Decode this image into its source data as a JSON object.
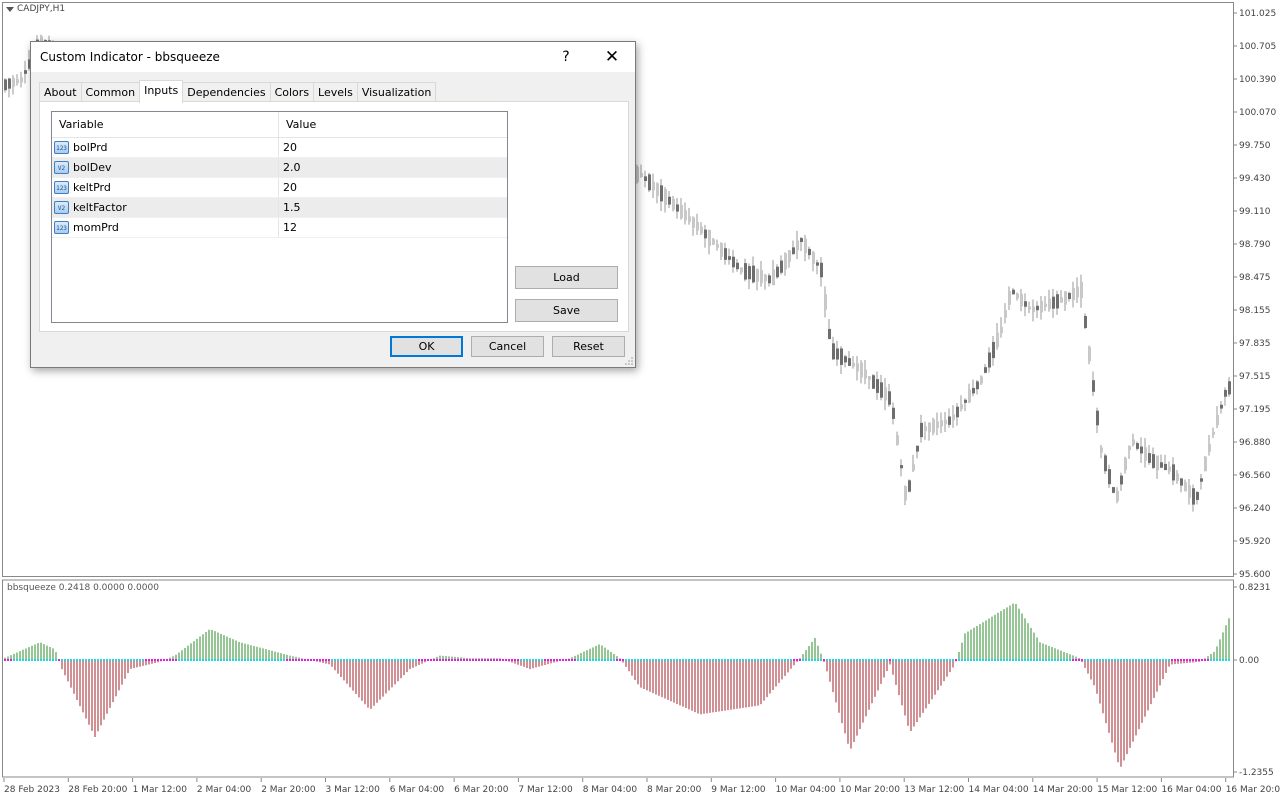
{
  "symbol": {
    "label": "CADJPY,H1"
  },
  "chart": {
    "price_ticks": [
      "101.025",
      "100.705",
      "100.390",
      "100.070",
      "99.750",
      "99.430",
      "99.110",
      "98.790",
      "98.475",
      "98.155",
      "97.835",
      "97.515",
      "97.195",
      "96.880",
      "96.560",
      "96.240",
      "95.920",
      "95.600"
    ],
    "time_ticks": [
      "28 Feb 2023",
      "28 Feb 20:00",
      "1 Mar 12:00",
      "2 Mar 04:00",
      "2 Mar 20:00",
      "3 Mar 12:00",
      "6 Mar 04:00",
      "6 Mar 20:00",
      "7 Mar 12:00",
      "8 Mar 04:00",
      "8 Mar 20:00",
      "9 Mar 12:00",
      "10 Mar 04:00",
      "10 Mar 20:00",
      "13 Mar 12:00",
      "14 Mar 04:00",
      "14 Mar 20:00",
      "15 Mar 12:00",
      "16 Mar 04:00",
      "16 Mar 20:00"
    ]
  },
  "indicator": {
    "label": "bbsqueeze 0.2418 0.0000 0.0000",
    "ticks": [
      "0.8231",
      "0.00",
      "-1.2355"
    ],
    "colors": {
      "up": "#2e8b2e",
      "down": "#a0202a",
      "squeeze_on": "#e020e0",
      "squeeze_off": "#20d8e0"
    }
  },
  "chart_data": {
    "type": "bar",
    "title": "bbsqueeze",
    "ylim": [
      -1.2355,
      0.8231
    ],
    "series": [
      {
        "name": "bbsqueeze",
        "last_value": 0.2418
      }
    ]
  },
  "dialog": {
    "title": "Custom Indicator - bbsqueeze",
    "help": "?",
    "close": "✕",
    "tabs": [
      "About",
      "Common",
      "Inputs",
      "Dependencies",
      "Colors",
      "Levels",
      "Visualization"
    ],
    "active_tab": "Inputs",
    "grid": {
      "col_variable": "Variable",
      "col_value": "Value",
      "rows": [
        {
          "icon": "int-icon",
          "badge": "123",
          "name": "bolPrd",
          "value": "20"
        },
        {
          "icon": "double-icon",
          "badge": "V2",
          "name": "bolDev",
          "value": "2.0"
        },
        {
          "icon": "int-icon",
          "badge": "123",
          "name": "keltPrd",
          "value": "20"
        },
        {
          "icon": "double-icon",
          "badge": "V2",
          "name": "keltFactor",
          "value": "1.5"
        },
        {
          "icon": "int-icon",
          "badge": "123",
          "name": "momPrd",
          "value": "12"
        }
      ]
    },
    "load": "Load",
    "save": "Save",
    "ok": "OK",
    "cancel": "Cancel",
    "reset": "Reset"
  }
}
